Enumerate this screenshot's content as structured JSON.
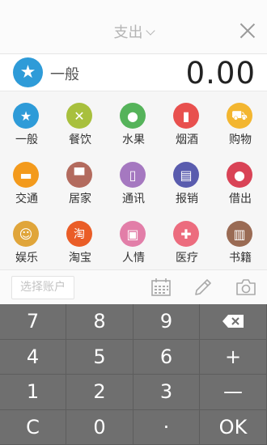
{
  "header": {
    "title": "支出"
  },
  "amount_row": {
    "category": "一般",
    "amount": "0.00"
  },
  "categories": [
    {
      "label": "一般",
      "color": "#2e9bd8",
      "icon": "star-icon",
      "glyph": "★"
    },
    {
      "label": "餐饮",
      "color": "#a8c03d",
      "icon": "fork-knife-icon",
      "glyph": "✕"
    },
    {
      "label": "水果",
      "color": "#55b35a",
      "icon": "apple-icon",
      "glyph": "●"
    },
    {
      "label": "烟酒",
      "color": "#e8504e",
      "icon": "bottle-icon",
      "glyph": "▮"
    },
    {
      "label": "购物",
      "color": "#f3b630",
      "icon": "cart-icon",
      "glyph": "⛟"
    },
    {
      "label": "交通",
      "color": "#f39a1c",
      "icon": "car-icon",
      "glyph": "▬"
    },
    {
      "label": "居家",
      "color": "#b36b5e",
      "icon": "sofa-icon",
      "glyph": "▀"
    },
    {
      "label": "通讯",
      "color": "#a578c0",
      "icon": "phone-icon",
      "glyph": "▯"
    },
    {
      "label": "报销",
      "color": "#5a5cae",
      "icon": "document-check-icon",
      "glyph": "▤"
    },
    {
      "label": "借出",
      "color": "#d94356",
      "icon": "user-lend-icon",
      "glyph": "●"
    },
    {
      "label": "娱乐",
      "color": "#e0a53a",
      "icon": "smile-icon",
      "glyph": "☺"
    },
    {
      "label": "淘宝",
      "color": "#ea5d27",
      "icon": "taobao-icon",
      "glyph": "淘"
    },
    {
      "label": "人情",
      "color": "#e27ea8",
      "icon": "gift-icon",
      "glyph": "▣"
    },
    {
      "label": "医疗",
      "color": "#ec6c7e",
      "icon": "medical-kit-icon",
      "glyph": "✚"
    },
    {
      "label": "书籍",
      "color": "#9a6b54",
      "icon": "book-icon",
      "glyph": "▥"
    }
  ],
  "toolbar": {
    "account_placeholder": "选择账户"
  },
  "keypad": [
    [
      "7",
      "8",
      "9",
      "⌫"
    ],
    [
      "4",
      "5",
      "6",
      "+"
    ],
    [
      "1",
      "2",
      "3",
      "—"
    ],
    [
      "C",
      "0",
      "·",
      "OK"
    ]
  ],
  "keypad_icons": {
    "backspace": "backspace-icon"
  }
}
